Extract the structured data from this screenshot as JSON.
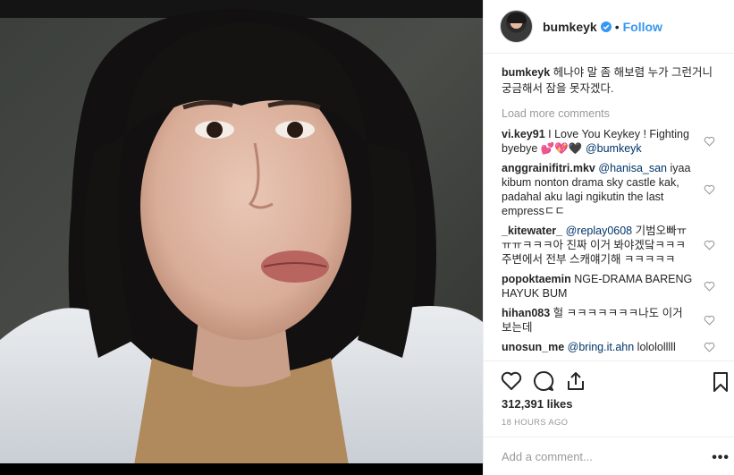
{
  "post": {
    "username": "bumkeyk",
    "follow_label": "Follow",
    "dot": "•",
    "caption": {
      "username": "bumkeyk",
      "text": "헤나야 말 좀 해보렴 누가 그런거니 궁금해서 잠을 못자겠다."
    },
    "load_more": "Load more comments",
    "comments": [
      {
        "user": "vi.key91",
        "text_before": "I Love You Keykey ! Fighting byebye 💕💖🖤 ",
        "mention": "@bumkeyk",
        "text_after": ""
      },
      {
        "user": "anggrainifitri.mkv",
        "text_before": "",
        "mention": "@hanisa_san",
        "text_after": " iyaa kibum nonton drama sky castle kak, padahal aku lagi ngikutin the last empressㄷㄷ"
      },
      {
        "user": "_kitewater_",
        "text_before": "",
        "mention": "@replay0608",
        "text_after": " 기범오빠ㅠㅠㅠㅋㅋㅋ아 진짜 이거 봐야겠닼ㅋㅋㅋ 주변에서 전부 스캐얘기해 ㅋㅋㅋㅋㅋ"
      },
      {
        "user": "popoktaemin",
        "text_before": "NGE-DRAMA BARENG HAYUK BUM",
        "mention": "",
        "text_after": ""
      },
      {
        "user": "hihan083",
        "text_before": "헐 ㅋㅋㅋㅋㅋㅋㅋ나도 이거 보는데",
        "mention": "",
        "text_after": ""
      },
      {
        "user": "unosun_me",
        "text_before": "",
        "mention": "@bring.it.ahn",
        "text_after": " lolololllll"
      }
    ],
    "likes": "312,391 likes",
    "time": "18 HOURS AGO",
    "add_comment_placeholder": "Add a comment...",
    "more_label": "•••"
  },
  "colors": {
    "accent": "#3897f0",
    "mention": "#003569",
    "muted": "#999999"
  },
  "icons": [
    "verified-icon",
    "heart-icon",
    "comment-icon",
    "share-icon",
    "bookmark-icon"
  ]
}
